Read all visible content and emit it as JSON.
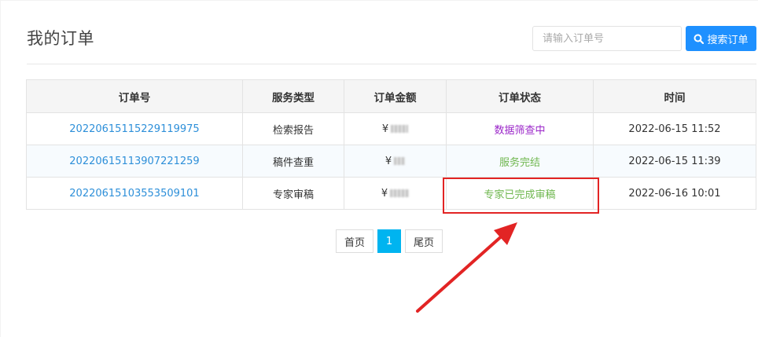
{
  "header": {
    "title": "我的订单",
    "search_placeholder": "请输入订单号",
    "search_button_label": "搜索订单"
  },
  "table": {
    "columns": [
      "订单号",
      "服务类型",
      "订单金额",
      "订单状态",
      "时间"
    ],
    "rows": [
      {
        "order_no": "20220615115229119975",
        "service_type": "检索报告",
        "amount": "¥",
        "status": "数据筛查中",
        "status_color": "#9b27c9",
        "time": "2022-06-15 11:52"
      },
      {
        "order_no": "20220615113907221259",
        "service_type": "稿件查重",
        "amount": "¥",
        "status": "服务完结",
        "status_color": "#6fb74f",
        "time": "2022-06-15 11:39"
      },
      {
        "order_no": "20220615103553509101",
        "service_type": "专家审稿",
        "amount": "¥",
        "status": "专家已完成审稿",
        "status_color": "#6fb74f",
        "time": "2022-06-16 10:01"
      }
    ]
  },
  "pagination": {
    "first_label": "首页",
    "current_page": "1",
    "last_label": "尾页"
  },
  "colors": {
    "accent": "#1e90ff",
    "link": "#2d8fd9",
    "active_page": "#00b4f0",
    "annotation": "#e22424"
  },
  "icons": {
    "search_button_icon": "search-icon"
  }
}
